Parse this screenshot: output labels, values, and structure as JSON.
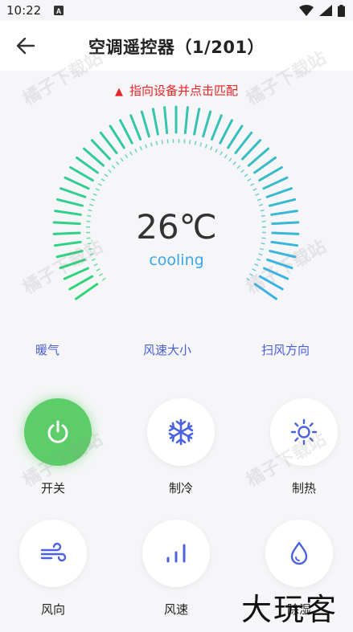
{
  "status": {
    "time": "10:22",
    "notif_icon": "a-square-icon"
  },
  "header": {
    "title": "空调遥控器（1/201）",
    "back_icon": "arrow-left-icon"
  },
  "hint": "指向设备并点击匹配",
  "display": {
    "temperature": "26℃",
    "mode": "cooling"
  },
  "functions": [
    "暖气",
    "风速大小",
    "扫风方向"
  ],
  "buttons": [
    {
      "label": "开关",
      "icon": "power-icon"
    },
    {
      "label": "制冷",
      "icon": "snowflake-icon"
    },
    {
      "label": "制热",
      "icon": "sun-icon"
    },
    {
      "label": "风向",
      "icon": "wind-icon"
    },
    {
      "label": "风速",
      "icon": "bars-icon"
    },
    {
      "label": "除湿",
      "icon": "droplet-icon"
    }
  ],
  "watermark": "橘子下载站",
  "brand": "大玩客",
  "colors": {
    "power": "#5ccd68",
    "accent": "#4a5fd6",
    "alert": "#e82323",
    "mode": "#3aa8e8"
  }
}
